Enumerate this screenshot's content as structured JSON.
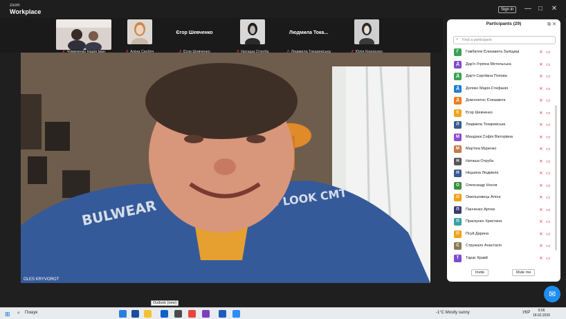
{
  "app": {
    "brand_small": "zoom",
    "brand_big": "Workplace",
    "signin_label": "Sign in"
  },
  "window_controls": [
    "—",
    "□",
    "✕"
  ],
  "thumbnails": [
    {
      "name": "Чумаченко Надія Іван",
      "type": "video"
    },
    {
      "name": "Аліна Скоблч",
      "type": "video"
    },
    {
      "name": "Єгор Шевченко",
      "type": "name-only",
      "display": "Єгор Шевченко"
    },
    {
      "name": "Наташа Отруба",
      "type": "video"
    },
    {
      "name": "Людмила Токаревська",
      "type": "name-only",
      "display": "Людмила Тока..."
    },
    {
      "name": "Юлія Корнієнко",
      "type": "video"
    }
  ],
  "main_video": {
    "speaker_label": "OLES KRYVOROT"
  },
  "participants": {
    "title": "Participants (29)",
    "search_placeholder": "Find a participant",
    "list": [
      {
        "initial": "Г",
        "name": "Гомбатюк Єлизавета Заліщиці",
        "color": "#3aa157"
      },
      {
        "initial": "Д",
        "name": "Дар'я Угріяна Метельська",
        "color": "#7b4bd1"
      },
      {
        "initial": "Д",
        "name": "Дар'я Сергіївна Попова",
        "color": "#3aa157"
      },
      {
        "initial": "Д",
        "name": "Доляко Марія-Стефанія",
        "color": "#1f7bd1"
      },
      {
        "initial": "Д",
        "name": "Довголетнс Єлизавета",
        "color": "#f07a1a"
      },
      {
        "initial": "Є",
        "name": "Єгор Шевченко",
        "color": "#f0a21a"
      },
      {
        "initial": "Л",
        "name": "Людмила Токаревська",
        "color": "#3a5a8f"
      },
      {
        "initial": "М",
        "name": "Мандзюк Софія Вікторівна",
        "color": "#8e4bd1"
      },
      {
        "initial": "М",
        "name": "Мар'яна Муренко",
        "color": "#c77a4a"
      },
      {
        "initial": "Н",
        "name": "Наташа Отруба",
        "color": "#555555"
      },
      {
        "initial": "Н",
        "name": "Ніцшина Людмила",
        "color": "#3a5a8f"
      },
      {
        "initial": "О",
        "name": "Олександр Носов",
        "color": "#3a8f3a"
      },
      {
        "initial": "О",
        "name": "Омельковець Алїна",
        "color": "#f0a21a"
      },
      {
        "initial": "П",
        "name": "Панченко Артем",
        "color": "#3a3a6f"
      },
      {
        "initial": "П",
        "name": "Праскунко Христина",
        "color": "#3aa1a1"
      },
      {
        "initial": "П",
        "name": "Псуй Дарина",
        "color": "#f0a21a"
      },
      {
        "initial": "С",
        "name": "Стружало Анастасія",
        "color": "#8a7a5a"
      },
      {
        "initial": "Т",
        "name": "Тарас Кравй",
        "color": "#7b4bd1"
      }
    ],
    "invite_label": "Invite",
    "mute_label": "Mute me"
  },
  "taskbar": {
    "search_label": "Пошук",
    "tooltip": "Outlook (new)",
    "weather": "-1°C  Mostly sunny",
    "lang": "УКР",
    "time": "9:06",
    "date": "18.02.2026"
  },
  "icons": {
    "search": "search-icon",
    "mic_off": "mic-off-icon",
    "cam_off": "camera-off-icon",
    "chat": "chat-icon",
    "windows": "windows-icon"
  }
}
